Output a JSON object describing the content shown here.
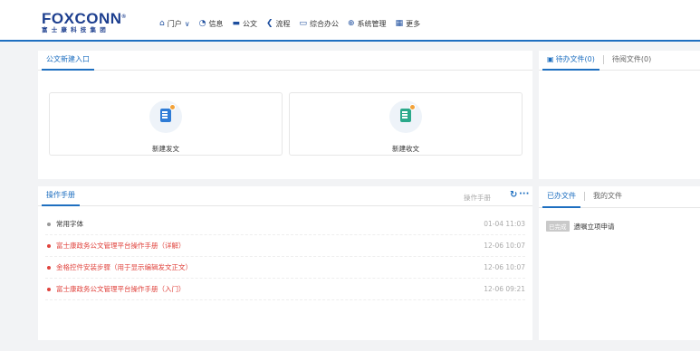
{
  "header": {
    "logo_main": "FOXCONN",
    "logo_reg": "®",
    "logo_sub": "富士康科技集团",
    "nav": [
      {
        "label": "门户",
        "icon": "home-icon",
        "glyph": "⌂",
        "has_dropdown": true
      },
      {
        "label": "信息",
        "icon": "chat-icon",
        "glyph": "◔"
      },
      {
        "label": "公文",
        "icon": "briefcase-icon",
        "glyph": "▬"
      },
      {
        "label": "流程",
        "icon": "share-icon",
        "glyph": "❮"
      },
      {
        "label": "综合办公",
        "icon": "monitor-icon",
        "glyph": "▭"
      },
      {
        "label": "系统管理",
        "icon": "system-icon",
        "glyph": "⊕"
      },
      {
        "label": "更多",
        "icon": "grid-icon",
        "glyph": "▦"
      }
    ]
  },
  "entry_panel": {
    "tab": "公文新建入口",
    "cards": [
      {
        "label": "新建发文",
        "doc_color": "#2f7cd6",
        "badge_color": "#f2a23a"
      },
      {
        "label": "新建收文",
        "doc_color": "#2ba98b",
        "badge_color": "#f2a23a"
      }
    ]
  },
  "pending_panel": {
    "tabs": [
      "待办文件(0)",
      "待阅文件(0)"
    ]
  },
  "manual_panel": {
    "tab": "操作手册",
    "more_label": "操作手册",
    "refresh_glyph": "↻",
    "more_glyph": "···",
    "items": [
      {
        "title": "常用字体",
        "date": "01-04 11:03",
        "color": "#333333",
        "dot": "#999999"
      },
      {
        "title": "富士康政务公文管理平台操作手册（详解）",
        "date": "12-06 10:07",
        "color": "#e0433d",
        "dot": "#e0433d"
      },
      {
        "title": "金格控件安装步骤（用于显示编辑发文正文）",
        "date": "12-06 10:07",
        "color": "#e0433d",
        "dot": "#e0433d"
      },
      {
        "title": "富士康政务公文管理平台操作手册（入门）",
        "date": "12-06 09:21",
        "color": "#e0433d",
        "dot": "#e0433d"
      }
    ]
  },
  "done_panel": {
    "tabs": [
      "已办文件",
      "我的文件"
    ],
    "items": [
      {
        "tag": "已完成",
        "title": "遗嘱立项申请"
      }
    ]
  },
  "colors": {
    "accent": "#1e6fc0",
    "brand": "#1d3f8f",
    "urgent": "#e0433d"
  }
}
